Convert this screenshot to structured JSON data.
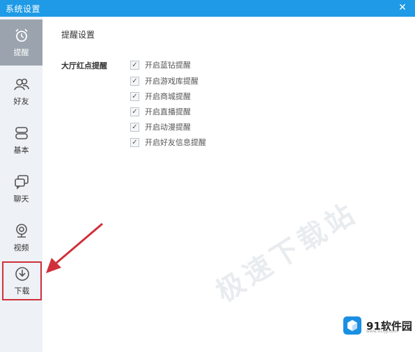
{
  "window": {
    "title": "系统设置"
  },
  "sidebar": {
    "items": [
      {
        "label": "提醒",
        "icon": "alarm-clock-icon",
        "active": true
      },
      {
        "label": "好友",
        "icon": "friends-icon",
        "active": false
      },
      {
        "label": "基本",
        "icon": "settings-basic-icon",
        "active": false
      },
      {
        "label": "聊天",
        "icon": "chat-icon",
        "active": false
      },
      {
        "label": "视频",
        "icon": "webcam-icon",
        "active": false
      },
      {
        "label": "下载",
        "icon": "download-icon",
        "active": false
      }
    ]
  },
  "main": {
    "section_title": "提醒设置",
    "group_label": "大厅红点提醒",
    "options": [
      {
        "label": "开启蓝钻提醒",
        "checked": true
      },
      {
        "label": "开启游戏库提醒",
        "checked": true
      },
      {
        "label": "开启商城提醒",
        "checked": true
      },
      {
        "label": "开启直播提醒",
        "checked": true
      },
      {
        "label": "开启动漫提醒",
        "checked": true
      },
      {
        "label": "开启好友信息提醒",
        "checked": true
      }
    ]
  },
  "watermark": "极速下载站",
  "logo": {
    "text": "91软件园",
    "url": "www.91rjy.com"
  },
  "colors": {
    "titlebar": "#1e9ae6",
    "sidebar_bg": "#eef1f5",
    "active_nav": "#9aa3ae",
    "annotation_red": "#d0303a"
  }
}
